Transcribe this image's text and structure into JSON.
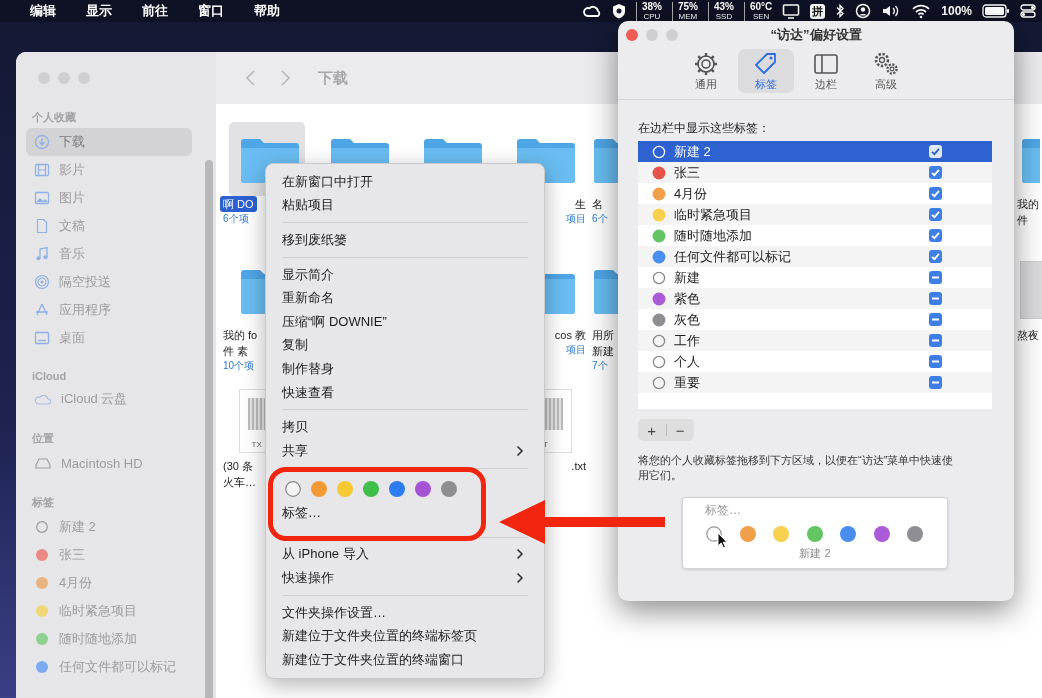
{
  "menubar": {
    "menus": [
      "编辑",
      "显示",
      "前往",
      "窗口",
      "帮助"
    ],
    "stats": [
      {
        "value": "38%",
        "label": "CPU"
      },
      {
        "value": "75%",
        "label": "MEM"
      },
      {
        "value": "43%",
        "label": "SSD"
      },
      {
        "value": "60°C",
        "label": "SEN"
      }
    ],
    "input_method": "拼",
    "battery": "100%"
  },
  "finder": {
    "title": "下载",
    "sidebar": [
      {
        "heading": "个人收藏",
        "items": [
          {
            "label": "下载",
            "kind": "download",
            "selected": true
          },
          {
            "label": "影片",
            "kind": "film",
            "selected": false
          },
          {
            "label": "图片",
            "kind": "photo",
            "selected": false
          },
          {
            "label": "文稿",
            "kind": "document",
            "selected": false
          },
          {
            "label": "音乐",
            "kind": "music",
            "selected": false
          },
          {
            "label": "隔空投送",
            "kind": "airdrop",
            "selected": false
          },
          {
            "label": "应用程序",
            "kind": "apps",
            "selected": false
          },
          {
            "label": "桌面",
            "kind": "desktop",
            "selected": false
          }
        ]
      },
      {
        "heading": "iCloud",
        "items": [
          {
            "label": "iCloud 云盘",
            "kind": "cloud",
            "selected": false
          }
        ]
      },
      {
        "heading": "位置",
        "items": [
          {
            "label": "Macintosh HD",
            "kind": "disk",
            "selected": false
          }
        ]
      },
      {
        "heading": "标签",
        "items": [
          {
            "label": "新建 2",
            "kind": "tag",
            "selected": false
          },
          {
            "label": "张三",
            "kind": "tag",
            "color": "#e98a86",
            "selected": false
          },
          {
            "label": "4月份",
            "kind": "tag",
            "color": "#eab27e",
            "selected": false
          },
          {
            "label": "临时紧急项目",
            "kind": "tag",
            "color": "#efd777",
            "selected": false
          },
          {
            "label": "随时随地添加",
            "kind": "tag",
            "color": "#8fd18f",
            "selected": false
          },
          {
            "label": "任何文件都可以标记",
            "kind": "tag",
            "color": "#7faaf0",
            "selected": false
          }
        ]
      }
    ],
    "files": {
      "columns": [
        [
          {
            "kind": "folder",
            "selected": true,
            "lines": [
              "啊 DO"
            ],
            "count": "6个项"
          },
          {
            "kind": "folder",
            "selected": false,
            "lines": [
              "我的 fo",
              "件 素"
            ],
            "count": "10个项"
          },
          {
            "kind": "doc",
            "selected": false,
            "badge": "TX",
            "lines": [
              "(30 条",
              "火车…"
            ]
          }
        ],
        [
          {
            "kind": "folder",
            "selected": false
          }
        ],
        [
          {
            "kind": "folder",
            "selected": false
          }
        ],
        [
          {
            "kind": "folder",
            "selected": false,
            "lines": [
              "生"
            ],
            "count": "项目"
          },
          {
            "kind": "folder",
            "selected": false,
            "lines": [
              "cos 教"
            ],
            "count": "项目"
          },
          {
            "kind": "doc",
            "selected": false,
            "badge": "T",
            "lines": [
              ".txt"
            ]
          }
        ],
        [
          {
            "kind": "folder",
            "selected": false,
            "lines": [
              "名"
            ],
            "count": "6个"
          },
          {
            "kind": "folder",
            "selected": false,
            "lines": [
              "用所",
              "新建"
            ],
            "count": "7个"
          }
        ],
        [
          {
            "kind": "folder",
            "selected": false,
            "lines": [
              "我的",
              "件"
            ]
          },
          {
            "kind": "photo",
            "selected": false,
            "lines": [
              "熬夜"
            ]
          }
        ]
      ]
    }
  },
  "context_menu": {
    "sections": [
      {
        "kind": "items",
        "items": [
          {
            "label": "在新窗口中打开",
            "submenu": false
          },
          {
            "label": "粘贴项目",
            "submenu": false
          }
        ]
      },
      {
        "kind": "items",
        "items": [
          {
            "label": "移到废纸篓",
            "submenu": false
          }
        ]
      },
      {
        "kind": "items",
        "items": [
          {
            "label": "显示简介",
            "submenu": false
          },
          {
            "label": "重新命名",
            "submenu": false
          },
          {
            "label": "压缩“啊 DOWNIE”",
            "submenu": false
          },
          {
            "label": "复制",
            "submenu": false
          },
          {
            "label": "制作替身",
            "submenu": false
          },
          {
            "label": "快速查看",
            "submenu": false
          }
        ]
      },
      {
        "kind": "items",
        "items": [
          {
            "label": "拷贝",
            "submenu": false
          },
          {
            "label": "共享",
            "submenu": true
          }
        ]
      },
      {
        "kind": "tags",
        "label": "标签…",
        "dots": [
          {
            "kind": "hollow"
          },
          {
            "kind": "color",
            "color": "#f39a36"
          },
          {
            "kind": "color",
            "color": "#f6c932"
          },
          {
            "kind": "color",
            "color": "#3fbf4a"
          },
          {
            "kind": "color",
            "color": "#2f7cf0"
          },
          {
            "kind": "color",
            "color": "#a455d4"
          },
          {
            "kind": "color",
            "color": "#8d8d92"
          }
        ]
      },
      {
        "kind": "items",
        "items": [
          {
            "label": "从 iPhone 导入",
            "submenu": true
          },
          {
            "label": "快速操作",
            "submenu": true
          }
        ]
      },
      {
        "kind": "items",
        "items": [
          {
            "label": "文件夹操作设置…",
            "submenu": false
          },
          {
            "label": "新建位于文件夹位置的终端标签页",
            "submenu": false
          },
          {
            "label": "新建位于文件夹位置的终端窗口",
            "submenu": false
          }
        ]
      }
    ]
  },
  "preferences": {
    "title": "“访达”偏好设置",
    "tabs": [
      {
        "label": "通用",
        "kind": "general",
        "selected": false
      },
      {
        "label": "标签",
        "kind": "tags",
        "selected": true
      },
      {
        "label": "边栏",
        "kind": "sidebar",
        "selected": false
      },
      {
        "label": "高级",
        "kind": "advanced",
        "selected": false
      }
    ],
    "list_label": "在边栏中显示这些标签：",
    "tags": [
      {
        "label": "新建 2",
        "checked": true,
        "selected": true
      },
      {
        "label": "张三",
        "color": "#e5534b",
        "checked": true,
        "selected": false
      },
      {
        "label": "4月份",
        "color": "#f0a04b",
        "checked": true,
        "selected": false
      },
      {
        "label": "临时紧急项目",
        "color": "#f7d04f",
        "checked": true,
        "selected": false
      },
      {
        "label": "随时随地添加",
        "color": "#62c462",
        "checked": true,
        "selected": false
      },
      {
        "label": "任何文件都可以标记",
        "color": "#4a8ef0",
        "checked": true,
        "selected": false
      },
      {
        "label": "新建",
        "checked": false,
        "selected": false
      },
      {
        "label": "紫色",
        "color": "#a95bd8",
        "checked": false,
        "selected": false
      },
      {
        "label": "灰色",
        "color": "#8e8e93",
        "checked": false,
        "selected": false
      },
      {
        "label": "工作",
        "checked": false,
        "selected": false
      },
      {
        "label": "个人",
        "checked": false,
        "selected": false
      },
      {
        "label": "重要",
        "checked": false,
        "selected": false
      }
    ],
    "add_button": "+",
    "remove_button": "−",
    "description": "将您的个人收藏标签拖移到下方区域，以便在“访达”菜单中快速使用它们。",
    "favorites": {
      "title": "标签…",
      "hover_label": "新建 2",
      "dots": [
        {
          "kind": "hollow"
        },
        {
          "kind": "color",
          "color": "#f0a04b"
        },
        {
          "kind": "color",
          "color": "#f7d04f"
        },
        {
          "kind": "color",
          "color": "#62c462"
        },
        {
          "kind": "color",
          "color": "#4a8ef0"
        },
        {
          "kind": "color",
          "color": "#a95bd8"
        },
        {
          "kind": "color",
          "color": "#8e8e93"
        }
      ]
    }
  }
}
